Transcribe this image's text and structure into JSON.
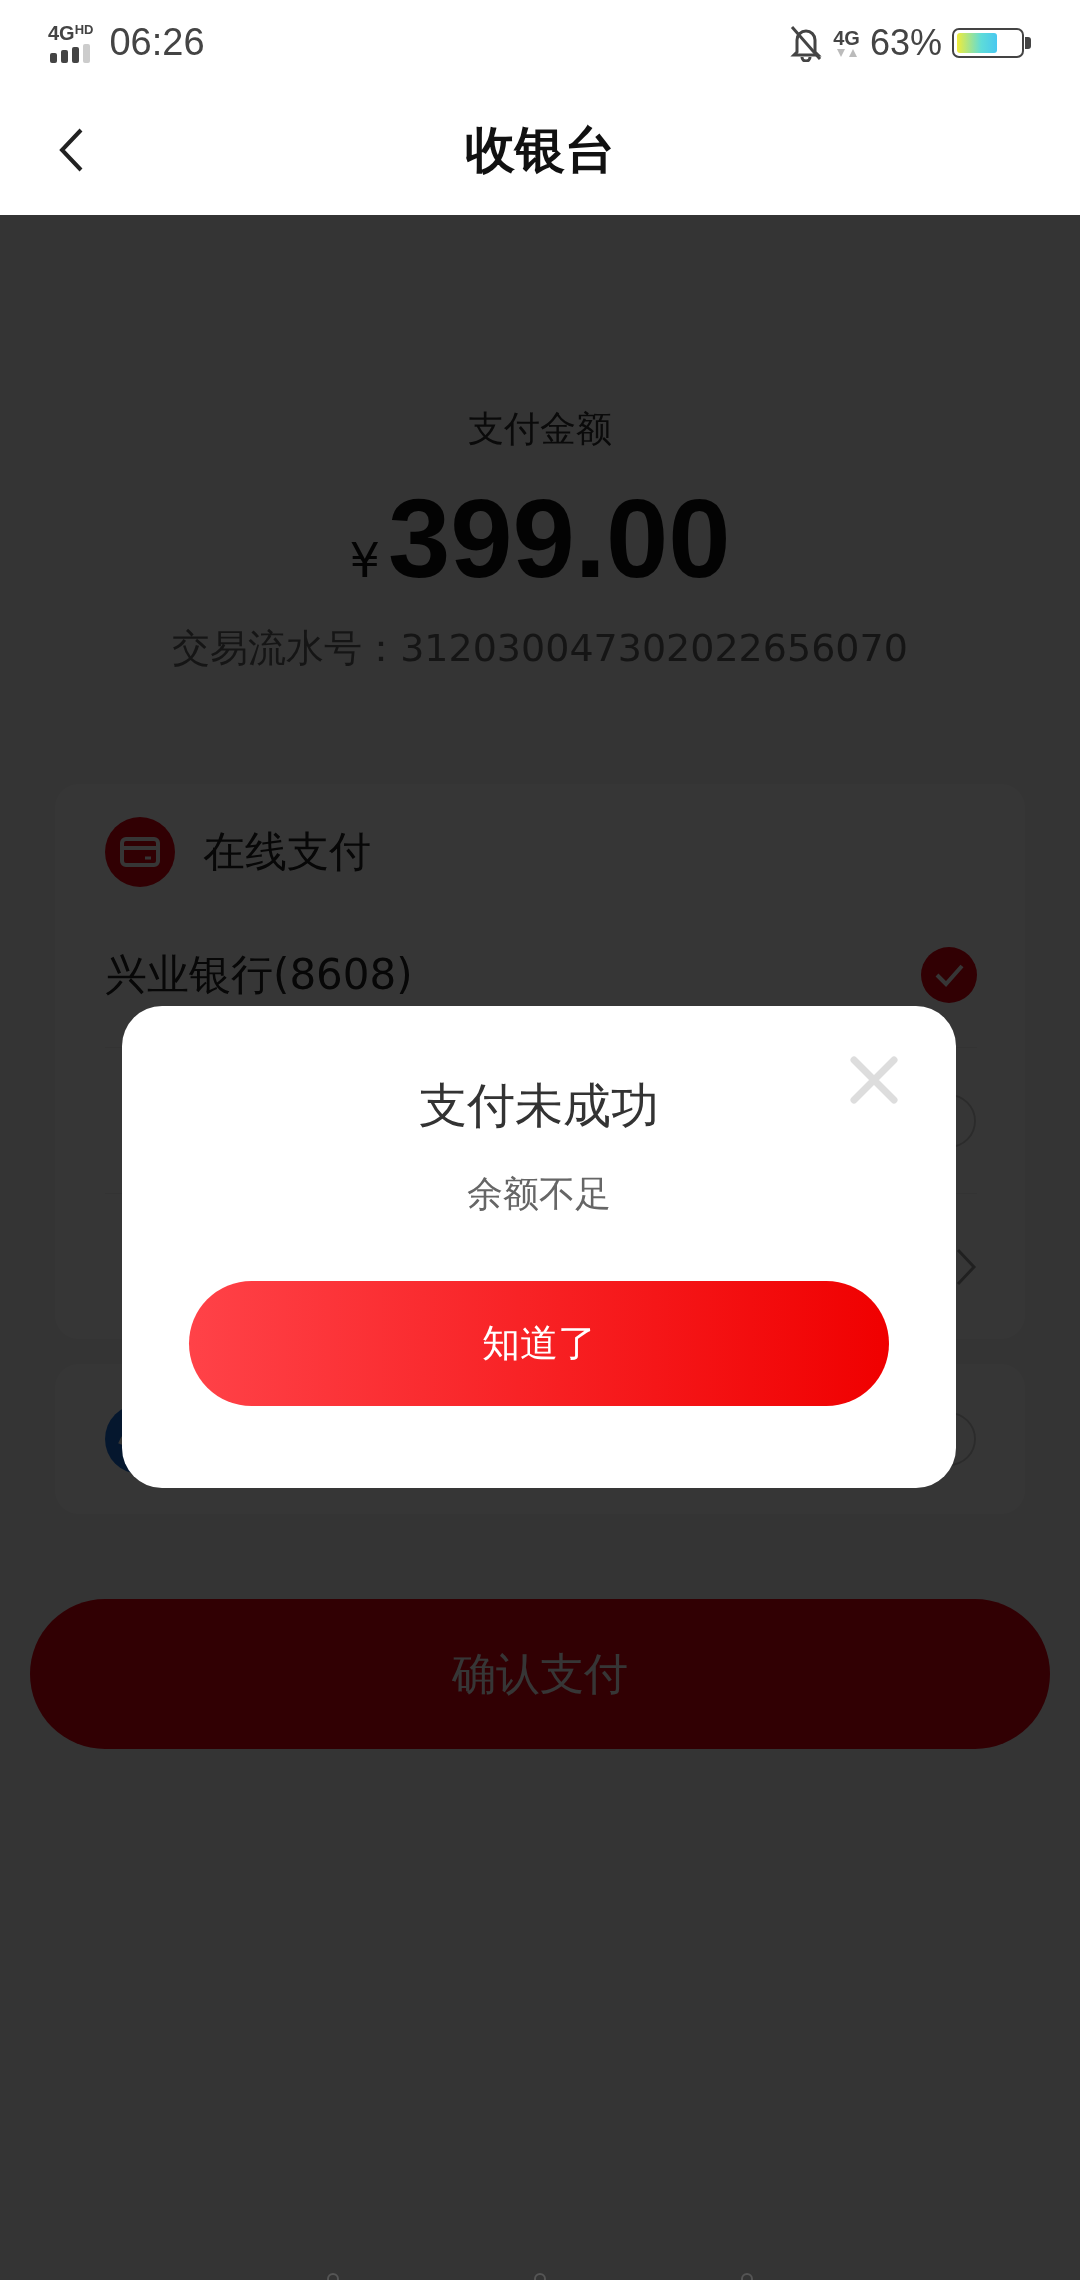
{
  "status_bar": {
    "signal": "4G",
    "signal_tag": "HD",
    "time": "06:26",
    "network": "4G",
    "battery": "63%"
  },
  "header": {
    "title": "收银台"
  },
  "payment": {
    "label": "支付金额",
    "currency": "¥",
    "amount": "399.00",
    "serial": "交易流水号：312030047302022656070"
  },
  "online_pay": {
    "title": "在线支付",
    "options": [
      {
        "kind": "option",
        "label": "兴业银行(8608)",
        "selected": true
      },
      {
        "kind": "option",
        "selected": false
      },
      {
        "kind": "more"
      }
    ]
  },
  "other_pay": {
    "selected": false
  },
  "confirm_button": "确认支付",
  "dialog": {
    "title": "支付未成功",
    "message": "余额不足",
    "button": "知道了"
  }
}
